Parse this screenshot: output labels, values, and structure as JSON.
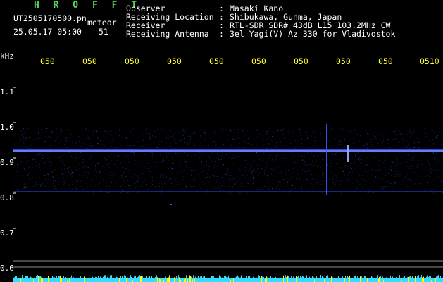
{
  "header": {
    "app_title": "H R O F F T",
    "file_name": "UT2505170500.pn",
    "meteor_label": "meteor",
    "datetime": "25.05.17 05:00",
    "count": "51",
    "info": [
      {
        "key": "Observer",
        "value": "Masaki Kano"
      },
      {
        "key": "Receiving Location",
        "value": "Shibukawa, Gunma, Japan"
      },
      {
        "key": "Receiver",
        "value": "RTL-SDR SDR# 43dB L15 103.2MHz CW"
      },
      {
        "key": "Receiving Antenna",
        "value": "3el Yagi(V) Az 330 for Vladivostok"
      }
    ],
    "separator": ":"
  },
  "axes": {
    "y_unit": "kHz",
    "y_ticks": [
      "1.1",
      "1.0",
      "0.9",
      "0.8",
      "0.7",
      "0.6"
    ],
    "x_ticks": [
      "050",
      "050",
      "050",
      "050",
      "050",
      "050",
      "050",
      "050",
      "050",
      "0510"
    ]
  },
  "colors": {
    "background": "#000000",
    "title": "#5cd65c",
    "time_ticks": "#ffff33",
    "signal": "#3355ff",
    "bar_fill": "#33ddff",
    "bar_spike": "#ffff00"
  }
}
